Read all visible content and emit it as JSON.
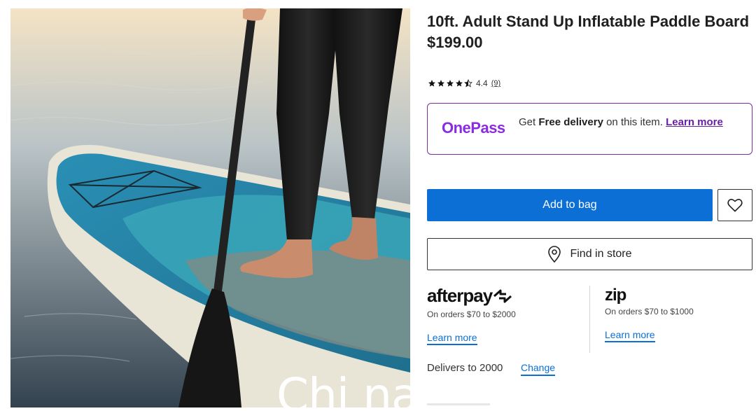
{
  "product": {
    "title": "10ft. Adult Stand Up Inflatable Paddle Board",
    "price": "$199.00",
    "image_alt": "Person standing barefoot on a teal paddle board holding a paddle",
    "watermark": "Chi na"
  },
  "rating": {
    "value": "4.4",
    "stars": 4.5,
    "review_count": "(9)"
  },
  "onepass": {
    "logo": "OnePass",
    "text_prefix": "Get ",
    "text_bold": "Free delivery",
    "text_suffix": " on this item.",
    "link": "Learn more",
    "accent": "#7b2d9e"
  },
  "actions": {
    "add_to_bag": "Add to bag",
    "wishlist_icon": "heart-icon",
    "find_in_store": "Find in store",
    "find_icon": "location-pin-icon",
    "primary_color": "#0b6fd6"
  },
  "payments": {
    "afterpay": {
      "logo": "afterpay",
      "note": "On orders $70 to $2000",
      "link": "Learn more"
    },
    "zip": {
      "logo": "zip",
      "note": "On orders $70 to $1000",
      "link": "Learn more"
    }
  },
  "delivery": {
    "text": "Delivers to 2000",
    "change": "Change"
  }
}
